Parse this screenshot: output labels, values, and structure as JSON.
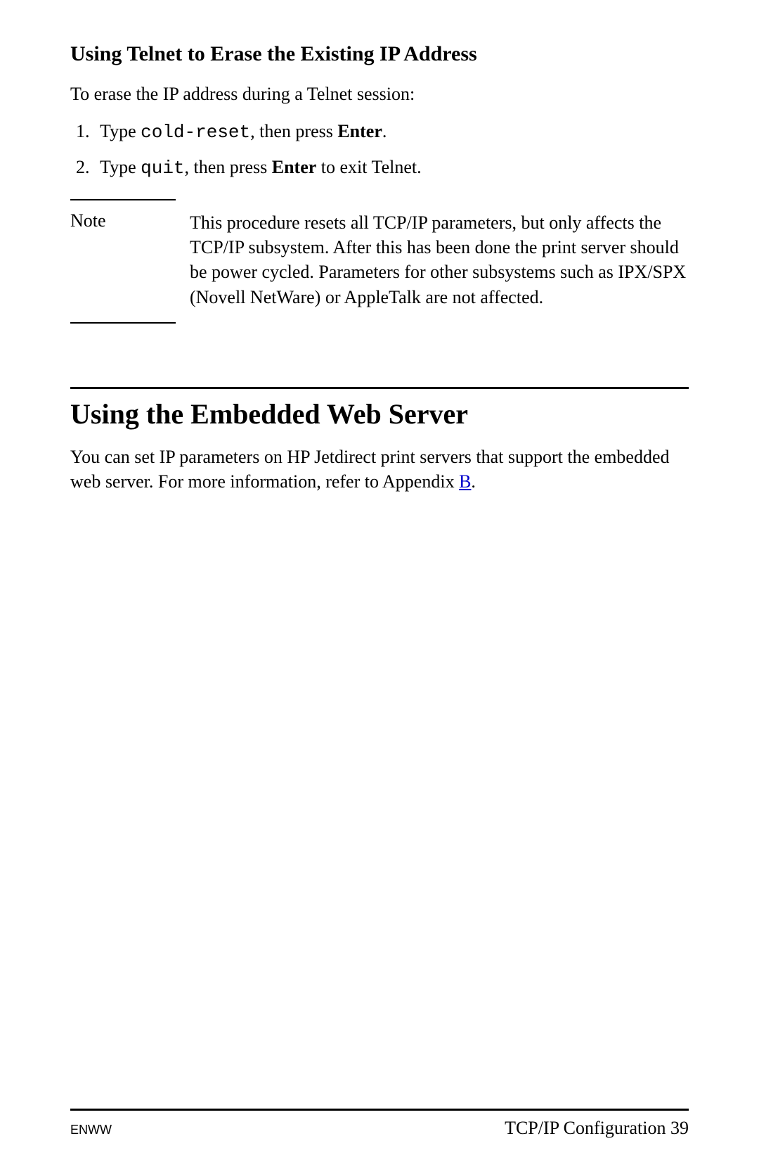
{
  "section1": {
    "heading": "Using Telnet to Erase the Existing IP Address",
    "intro": "To erase the IP address during a Telnet session:",
    "steps": [
      {
        "prefix": "Type ",
        "code": "cold-reset",
        "mid": ", then press ",
        "bold": "Enter",
        "suffix": "."
      },
      {
        "prefix": "Type ",
        "code": "quit",
        "mid": ", then press ",
        "bold": "Enter",
        "suffix": " to exit Telnet."
      }
    ]
  },
  "note": {
    "label": "Note",
    "text": "This procedure resets all TCP/IP parameters, but only affects the TCP/IP subsystem. After this has been done the print server should be power cycled. Parameters for other subsystems such as IPX/SPX (Novell NetWare) or AppleTalk are not affected."
  },
  "section2": {
    "heading": "Using the Embedded Web Server",
    "para_pre": "You can set IP parameters on HP Jetdirect print servers that support the embedded web server. For more information, refer to Appendix ",
    "link_text": "B",
    "para_post": "."
  },
  "footer": {
    "left": "ENWW",
    "right_label": "TCP/IP Configuration ",
    "right_page": "39"
  }
}
